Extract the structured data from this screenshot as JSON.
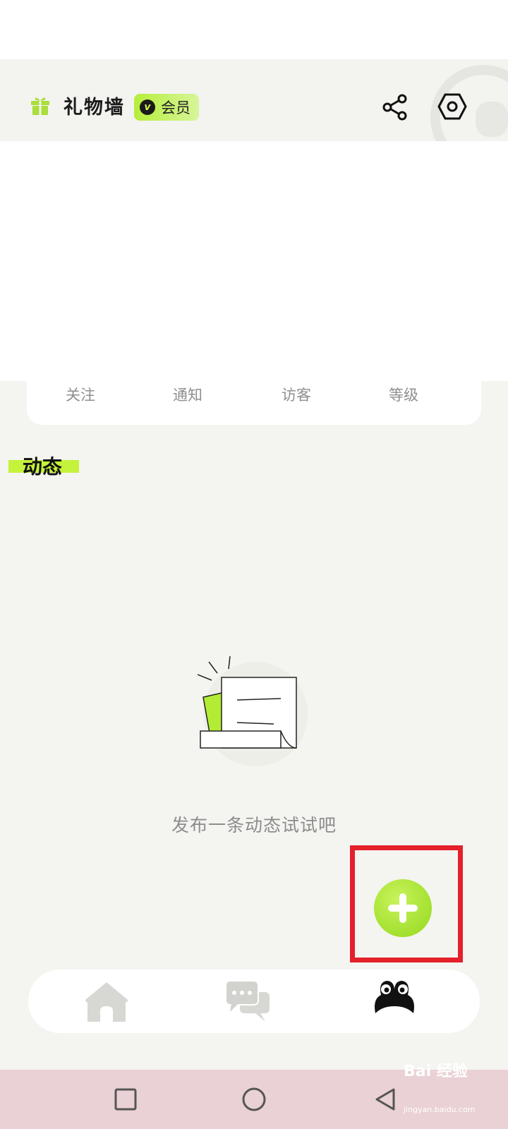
{
  "header": {
    "title": "礼物墙",
    "vip_letter": "v",
    "vip_label": "会员",
    "share_icon": "share-icon",
    "settings_icon": "settings-hex-icon"
  },
  "stats": [
    "关注",
    "通知",
    "访客",
    "等级"
  ],
  "section": {
    "title": "动态"
  },
  "empty_state": {
    "text": "发布一条动态试试吧"
  },
  "fab": {
    "icon": "plus-icon"
  },
  "bottom_nav": {
    "items": [
      {
        "name": "home",
        "icon": "home-icon"
      },
      {
        "name": "messages",
        "icon": "chat-bubbles-icon"
      },
      {
        "name": "profile",
        "icon": "frog-face-icon"
      }
    ]
  },
  "watermark": {
    "text": "Bai 经验",
    "sub": "jingyan.baidu.com"
  },
  "colors": {
    "accent": "#b6ee3a",
    "fab": "#9ddf22",
    "highlight": "#e4202a",
    "background": "#f4f4f1"
  }
}
